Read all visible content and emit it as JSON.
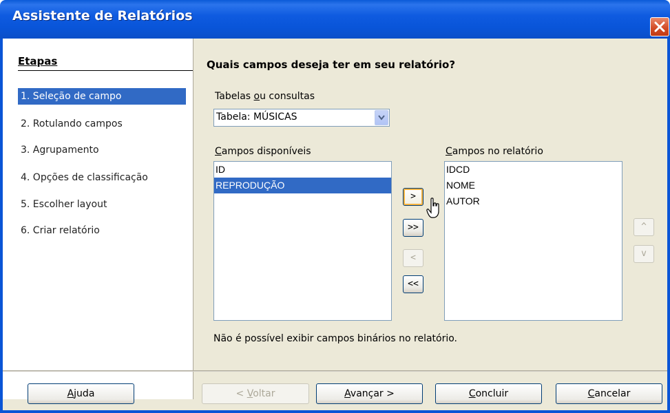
{
  "window": {
    "title": "Assistente de Relatórios"
  },
  "steps": {
    "heading": "Etapas",
    "items": [
      {
        "label": "1. Seleção de campo",
        "selected": true
      },
      {
        "label": "2. Rotulando campos",
        "selected": false
      },
      {
        "label": "3. Agrupamento",
        "selected": false
      },
      {
        "label": "4. Opções de classificação",
        "selected": false
      },
      {
        "label": "5. Escolher layout",
        "selected": false
      },
      {
        "label": "6. Criar relatório",
        "selected": false
      }
    ]
  },
  "main": {
    "question": "Quais campos deseja ter em seu relatório?",
    "tables_label_pre": "Tabelas ",
    "tables_label_u": "o",
    "tables_label_post": "u consultas",
    "table_select_value": "Tabela: MÚSICAS",
    "available_label_u": "C",
    "available_label_rest": "ampos disponíveis",
    "report_label_u": "C",
    "report_label_rest": "ampos no relatório",
    "available_fields": [
      "ID",
      "REPRODUÇÃO"
    ],
    "available_selected_index": 1,
    "report_fields": [
      "IDCD",
      "NOME",
      "AUTOR"
    ],
    "transfer_buttons": {
      "add_one": ">",
      "add_all": ">>",
      "remove_one": "<",
      "remove_all": "<<"
    },
    "order_buttons": {
      "up": "^",
      "down": "v"
    },
    "note": "Não é possível exibir campos binários no relatório."
  },
  "footer": {
    "help_u": "A",
    "help_rest": "juda",
    "back_pre": "< ",
    "back_u": "V",
    "back_rest": "oltar",
    "next_u": "A",
    "next_rest": "vançar >",
    "finish_pre": "",
    "finish_u": "C",
    "finish_rest": "oncluir",
    "cancel_u": "C",
    "cancel_rest": "ancelar"
  },
  "colors": {
    "titlebar": "#0a55d6",
    "selection": "#316ac5",
    "dialog_bg": "#ece9d8"
  },
  "icons": {
    "close": "close-icon",
    "dropdown": "chevron-down-icon",
    "cursor": "mouse-pointer-icon"
  }
}
